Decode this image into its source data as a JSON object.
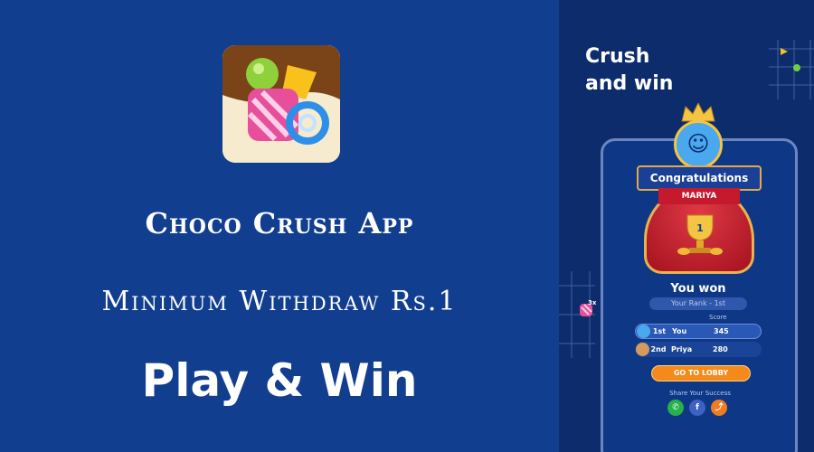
{
  "banner": {
    "app_name": "Choco Crush App",
    "withdraw": "Minimum Withdraw Rs.1",
    "tagline": "Play & Win"
  },
  "promo": {
    "headline_line1": "Crush",
    "headline_line2": "and win",
    "multiplier": "3x",
    "congratulations": "Congratulations",
    "player_name": "MARIYA",
    "trophy_rank": "1",
    "you_won": "You won",
    "your_rank": "Your Rank - 1st",
    "score_header": "Score",
    "leaderboard": [
      {
        "position": "1st",
        "name": "You",
        "score": "345"
      },
      {
        "position": "2nd",
        "name": "Priya",
        "score": "280"
      }
    ],
    "lobby_button": "GO TO LOBBY",
    "share_label": "Share Your Success",
    "share_icons": [
      "whatsapp-icon",
      "facebook-icon",
      "share-icon"
    ]
  },
  "colors": {
    "background": "#123e8f",
    "panel": "#0d2c6c",
    "accent_orange": "#f48a1c",
    "gold": "#e8b24f",
    "red": "#c5192d"
  }
}
